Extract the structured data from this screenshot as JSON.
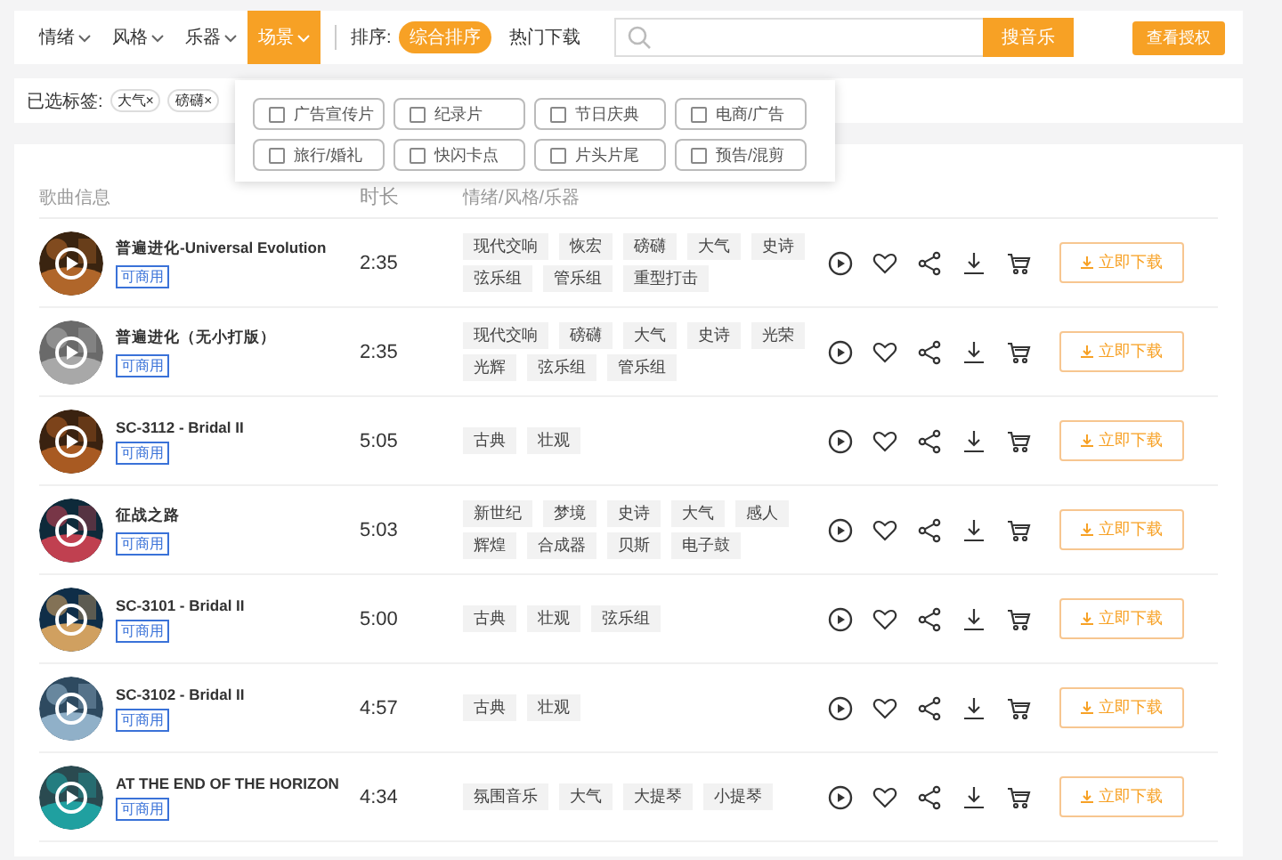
{
  "filters": [
    {
      "label": "情绪",
      "selected": false
    },
    {
      "label": "风格",
      "selected": false
    },
    {
      "label": "乐器",
      "selected": false
    },
    {
      "label": "场景",
      "selected": true
    }
  ],
  "sort": {
    "label": "排序:",
    "options": [
      {
        "label": "综合排序",
        "selected": true
      },
      {
        "label": "热门下载",
        "selected": false
      }
    ]
  },
  "search": {
    "button": "搜音乐"
  },
  "license_button": "查看授权",
  "selected_tags": {
    "label": "已选标签:",
    "tags": [
      "大气",
      "磅礴"
    ],
    "remove": "×"
  },
  "scene_dropdown": {
    "options": [
      {
        "label": "广告宣传片",
        "checked": false
      },
      {
        "label": "纪录片",
        "checked": false
      },
      {
        "label": "节日庆典",
        "checked": false
      },
      {
        "label": "电商/广告",
        "checked": false
      },
      {
        "label": "旅行/婚礼",
        "checked": false
      },
      {
        "label": "快闪卡点",
        "checked": false
      },
      {
        "label": "片头片尾",
        "checked": false
      },
      {
        "label": "预告/混剪",
        "checked": false
      }
    ]
  },
  "table": {
    "columns": [
      "歌曲信息",
      "时长",
      "情绪/风格/乐器"
    ],
    "rows": [
      {
        "title": "普遍进化-Universal Evolution",
        "badge": "可商用",
        "duration": "2:35",
        "tags": [
          "现代交响",
          "恢宏",
          "磅礴",
          "大气",
          "史诗",
          "弦乐组",
          "管乐组",
          "重型打击"
        ],
        "download": "立即下载"
      },
      {
        "title": "普遍进化（无小打版）",
        "badge": "可商用",
        "duration": "2:35",
        "tags": [
          "现代交响",
          "磅礴",
          "大气",
          "史诗",
          "光荣",
          "光辉",
          "弦乐组",
          "管乐组"
        ],
        "download": "立即下载"
      },
      {
        "title": "SC-3112 - Bridal II",
        "badge": "可商用",
        "duration": "5:05",
        "tags": [
          "古典",
          "壮观"
        ],
        "download": "立即下载"
      },
      {
        "title": "征战之路",
        "badge": "可商用",
        "duration": "5:03",
        "tags": [
          "新世纪",
          "梦境",
          "史诗",
          "大气",
          "感人",
          "辉煌",
          "合成器",
          "贝斯",
          "电子鼓"
        ],
        "download": "立即下载"
      },
      {
        "title": "SC-3101 - Bridal II",
        "badge": "可商用",
        "duration": "5:00",
        "tags": [
          "古典",
          "壮观",
          "弦乐组"
        ],
        "download": "立即下载"
      },
      {
        "title": "SC-3102 - Bridal II",
        "badge": "可商用",
        "duration": "4:57",
        "tags": [
          "古典",
          "壮观"
        ],
        "download": "立即下载"
      },
      {
        "title": "AT THE END OF THE HORIZON",
        "badge": "可商用",
        "duration": "4:34",
        "tags": [
          "氛围音乐",
          "大气",
          "大提琴",
          "小提琴"
        ],
        "download": "立即下载"
      }
    ]
  }
}
